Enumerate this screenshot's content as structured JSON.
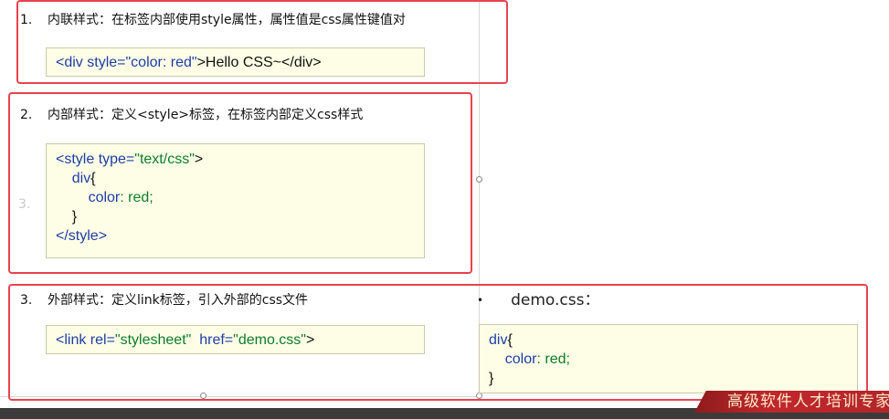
{
  "section1": {
    "number": "1.",
    "title": "内联样式：在标签内部使用style属性，属性值是css属性键值对",
    "code": {
      "open": "<div ",
      "attr": "style=",
      "value": "\"color: red\"",
      "close": ">Hello CSS~</div>"
    }
  },
  "section2": {
    "number": "2.",
    "title": "内部样式：定义<style>标签，在标签内部定义css样式",
    "ghost_number": "3.",
    "code": {
      "line1_tag": "<style ",
      "line1_attr": "type=",
      "line1_value": "\"text/css\"",
      "line1_close": ">",
      "line2_sel": "div",
      "line2_brace": "{",
      "line3_prop": "color",
      "line3_rest": ": red;",
      "line4": "}",
      "line5": "</style>"
    }
  },
  "section3": {
    "number": "3.",
    "title": "外部样式：定义link标签，引入外部的css文件",
    "code": {
      "tag": "<link ",
      "attr1": "rel=",
      "val1": "\"stylesheet\"",
      "attr2": "href=",
      "val2": "\"demo.css\"",
      "close": ">"
    }
  },
  "demo": {
    "bullet": "•",
    "filename": "demo.css：",
    "code": {
      "line1_sel": "div",
      "line1_brace": "{",
      "line2_prop": "color",
      "line2_rest": ": red;",
      "line3": "}"
    }
  },
  "banner": {
    "text": "高级软件人才培训专家"
  },
  "colors": {
    "highlight": "#e8434e",
    "keyword": "#1d3da8",
    "string": "#0c7d2c",
    "code_bg": "#fefee6"
  }
}
